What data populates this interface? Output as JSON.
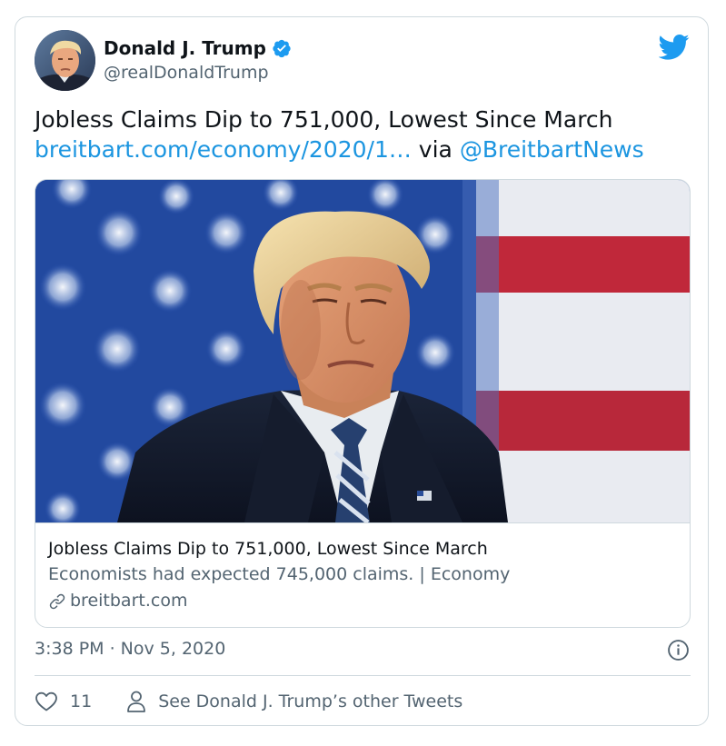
{
  "author": {
    "display_name": "Donald J. Trump",
    "handle": "@realDonaldTrump",
    "verified_icon": "verified-badge-icon",
    "verified_color": "#1d9bf0"
  },
  "brand_icon": "twitter-bird-icon",
  "brand_color": "#1d9bf0",
  "tweet": {
    "text_line1": "Jobless Claims Dip to 751,000, Lowest Since March",
    "link_text": "breitbart.com/economy/2020/1…",
    "via_text": " via ",
    "mention": "@BreitbartNews"
  },
  "link_color": "#1b95e0",
  "card": {
    "title": "Jobless Claims Dip to 751,000, Lowest Since March",
    "description": "Economists had expected 745,000 claims. | Economy",
    "domain": "breitbart.com",
    "domain_icon": "link-icon"
  },
  "meta": {
    "timestamp": "3:38 PM · Nov 5, 2020",
    "info_icon": "info-icon"
  },
  "actions": {
    "like_count": "11",
    "like_icon": "heart-icon",
    "other_tweets_label": "See Donald J. Trump’s other Tweets",
    "other_tweets_icon": "person-icon"
  }
}
